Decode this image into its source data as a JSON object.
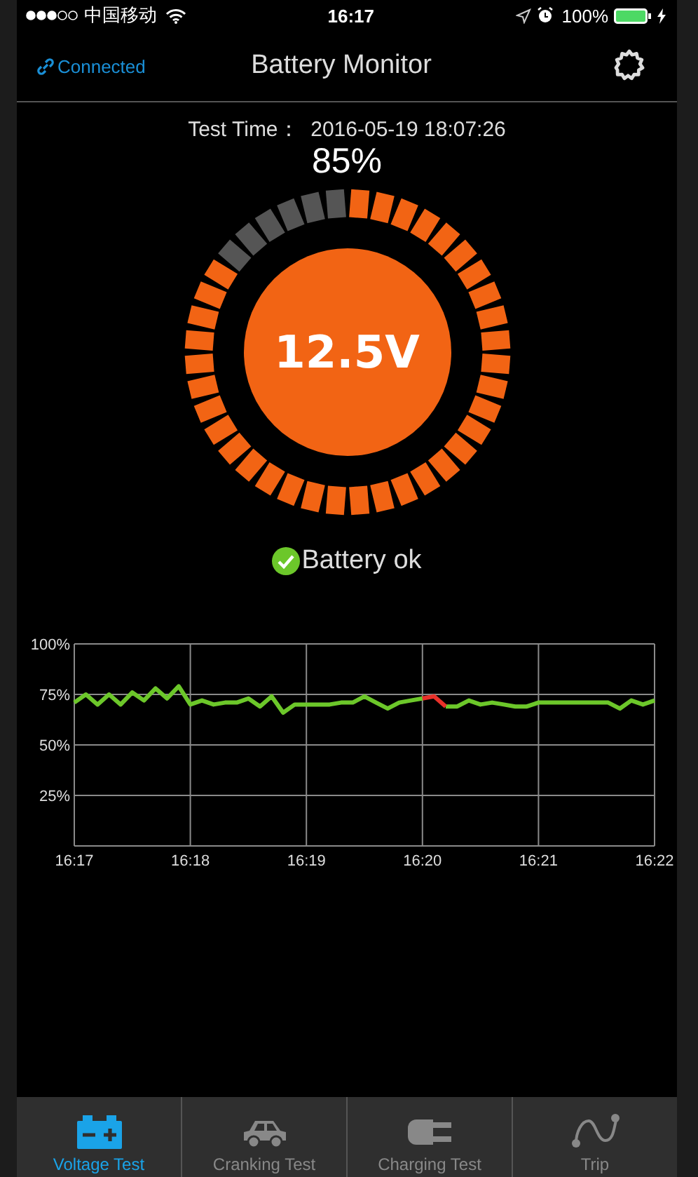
{
  "status_bar": {
    "carrier": "中国移动",
    "time": "16:17",
    "battery": "100%"
  },
  "header": {
    "connection": "Connected",
    "title": "Battery Monitor"
  },
  "test_time": "Test Time：  2016-05-19 18:07:26",
  "charge": "85%",
  "gauge": {
    "voltage": "12.5V"
  },
  "status": {
    "text": "Battery ok",
    "ok": true
  },
  "chart_data": {
    "type": "line",
    "categories": [
      "16:17",
      null,
      null,
      null,
      null,
      null,
      null,
      null,
      null,
      null,
      "16:18",
      null,
      null,
      null,
      null,
      null,
      null,
      null,
      null,
      null,
      "16:19",
      null,
      null,
      null,
      null,
      null,
      null,
      null,
      null,
      null,
      "16:20",
      null,
      null,
      null,
      null,
      null,
      null,
      null,
      null,
      null,
      "16:21",
      null,
      null,
      null,
      null,
      null,
      null,
      null,
      null,
      null,
      "16:22"
    ],
    "series": [
      {
        "color": "#6cc72a",
        "values": [
          71,
          75,
          70,
          75,
          70,
          76,
          72,
          78,
          73,
          79,
          70,
          72,
          70,
          71,
          71,
          73,
          69,
          74,
          66,
          70,
          70,
          70,
          70,
          71,
          71,
          74,
          71,
          68,
          71,
          72,
          73,
          null,
          69,
          69,
          72,
          70,
          71,
          70,
          69,
          69,
          71,
          71,
          71,
          71,
          71,
          71,
          71,
          68,
          72,
          70,
          72
        ]
      },
      {
        "color": "#e8312a",
        "values": [
          null,
          null,
          null,
          null,
          null,
          null,
          null,
          null,
          null,
          null,
          null,
          null,
          null,
          null,
          null,
          null,
          null,
          null,
          null,
          null,
          null,
          null,
          null,
          null,
          null,
          null,
          null,
          null,
          null,
          null,
          73,
          74,
          69,
          null,
          null,
          null,
          null,
          null,
          null,
          null,
          null,
          null,
          null,
          null,
          null,
          null,
          null,
          null,
          null,
          null,
          null
        ]
      }
    ],
    "ylim": [
      0,
      100
    ],
    "grid": true,
    "yticks": [
      {
        "value": 25,
        "label": "25%"
      },
      {
        "value": 50,
        "label": "50%"
      },
      {
        "value": 75,
        "label": "75%"
      },
      {
        "value": 100,
        "label": "100%"
      }
    ]
  },
  "tabs": [
    {
      "label": "Voltage Test",
      "kind": "battery",
      "selected": true
    },
    {
      "label": "Cranking Test",
      "kind": "car",
      "selected": false
    },
    {
      "label": "Charging Test",
      "kind": "plug",
      "selected": false
    },
    {
      "label": "Trip",
      "kind": "route",
      "selected": false
    }
  ]
}
